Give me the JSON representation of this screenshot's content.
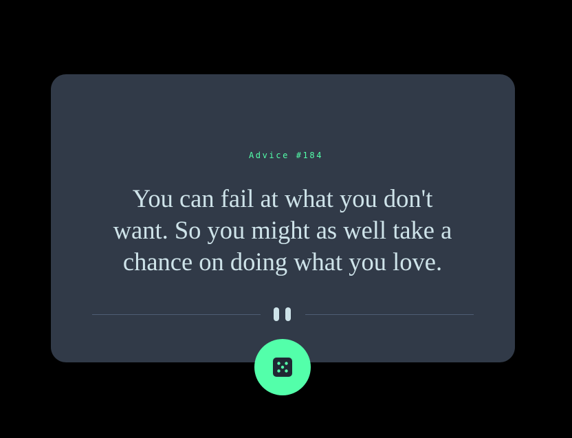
{
  "advice": {
    "label": "Advice #184",
    "quote": "You can fail at what you don't want. So you might as well take a chance on doing what you love."
  },
  "icons": {
    "divider": "pause-icon",
    "button": "dice-icon"
  },
  "colors": {
    "background": "#000000",
    "card": "#313a48",
    "accent": "#53ffaa",
    "text": "#cee3e9",
    "divider": "#4f5d74",
    "dice": "#202733"
  }
}
